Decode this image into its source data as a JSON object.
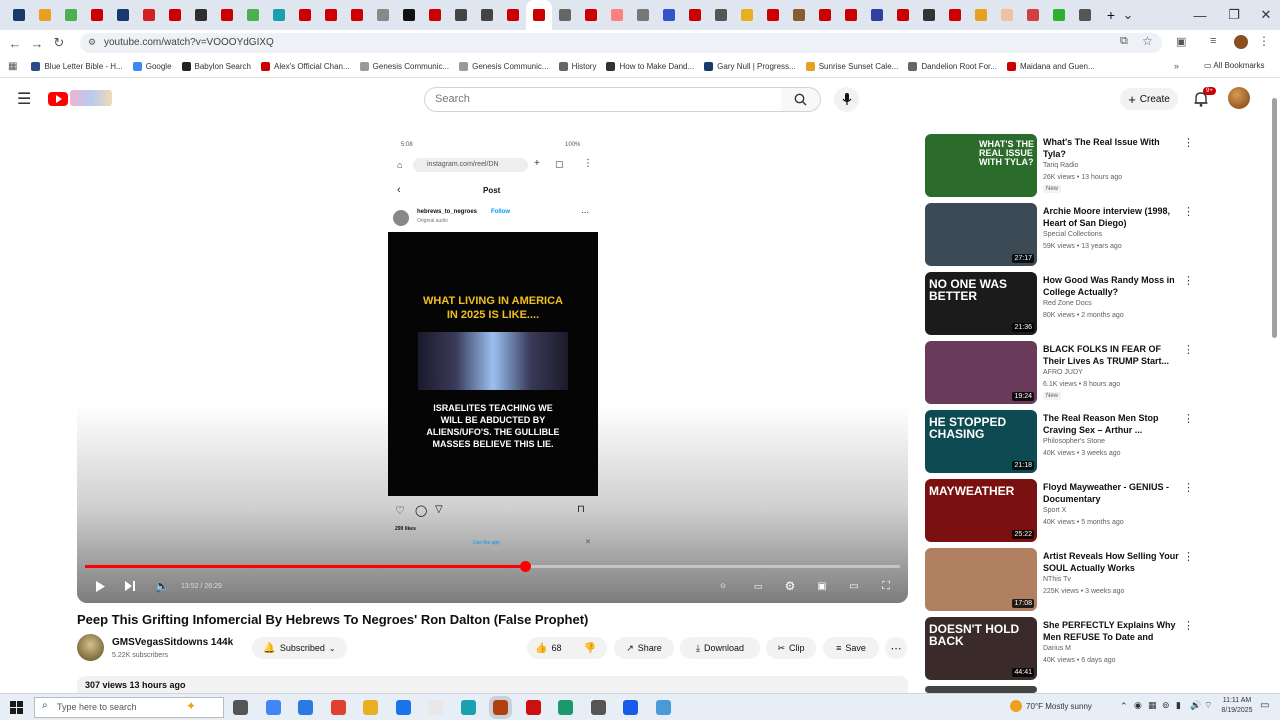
{
  "browser": {
    "tab_colors": [
      "#1a3a6b",
      "#e8a020",
      "#4caf50",
      "#cc0000",
      "#1a3a6b",
      "#d42020",
      "#cc0000",
      "#2f2f2f",
      "#cc0000",
      "#4caf50",
      "#1aa0b0",
      "#cc0000",
      "#cc0000",
      "#cc0000",
      "#888888",
      "#111111",
      "#cc0000",
      "#444444",
      "#444444",
      "#cc0000",
      "#cc0000",
      "#666666",
      "#cc0000",
      "#ff8080",
      "#777777",
      "#3355cc",
      "#cc0000",
      "#555555",
      "#e8b020",
      "#cc0000",
      "#8a5a30",
      "#cc0000",
      "#cc0000",
      "#3040a0",
      "#cc0000",
      "#333333",
      "#cc0000",
      "#e8a020",
      "#f0c0a0",
      "#d04040",
      "#30b030",
      "#555555"
    ],
    "url": "youtube.com/watch?v=VOOOYdGIXQ",
    "bookmarks": [
      {
        "label": "Blue Letter Bible - H...",
        "color": "#2a4a8a"
      },
      {
        "label": "Google",
        "color": "#4285f4"
      },
      {
        "label": "Babylon Search",
        "color": "#222222"
      },
      {
        "label": "Alex's Official Chan...",
        "color": "#cc0000"
      },
      {
        "label": "Genesis Communic...",
        "color": "#999999"
      },
      {
        "label": "Genesis Communic...",
        "color": "#999999"
      },
      {
        "label": "History",
        "color": "#666666"
      },
      {
        "label": "How to Make Dand...",
        "color": "#333333"
      },
      {
        "label": "Gary Null | Progress...",
        "color": "#1a3a6b"
      },
      {
        "label": "Sunrise Sunset Cale...",
        "color": "#e8a020"
      },
      {
        "label": "Dandelion Root For...",
        "color": "#666666"
      },
      {
        "label": "Maidana and Guen...",
        "color": "#cc0000"
      }
    ],
    "all_bookmarks": "All Bookmarks"
  },
  "header": {
    "search_placeholder": "Search",
    "create_label": "Create",
    "bell_badge": "9+"
  },
  "player": {
    "status_time": "5:08",
    "status_battery": "100%",
    "phone_url": "instagram.com/reel/DN",
    "post_header": "Post",
    "post_user": "hebrews_to_negroes",
    "post_follow": "Follow",
    "post_audio": "Original audio",
    "post_text_top": "WHAT LIVING IN AMERICA IN 2025 IS LIKE....",
    "post_text_bottom": "ISRAELITES TEACHING WE WILL BE ABDUCTED BY ALIENS/UFO'S. THE GULLIBLE MASSES BELIEVE THIS LIE.",
    "likes": "299 likes",
    "use_app": "Use the app",
    "time_display": "13:52 / 26:29",
    "progress": 0.54,
    "quality_badge": "HD"
  },
  "video": {
    "title": "Peep This Grifting Infomercial By Hebrews To Negroes' Ron Dalton (False Prophet)",
    "channel": "GMSVegasSitdowns 144k",
    "subscribers": "5.22K subscribers",
    "subscribed": "Subscribed",
    "likes": "68",
    "share": "Share",
    "download": "Download",
    "clip": "Clip",
    "save": "Save",
    "views": "307 views  13 hours ago"
  },
  "recommendations": [
    {
      "title": "What's The Real Issue With Tyla?",
      "channel": "Tariq Radio",
      "meta": "26K views • 13 hours ago",
      "badge": "New",
      "thumb_text": "WHAT'S THE REAL ISSUE WITH TYLA?",
      "bg": "#2b6b2b"
    },
    {
      "title": "Archie Moore interview (1998, Heart of San Diego)",
      "channel": "Special Collections",
      "meta": "59K views • 13 years ago",
      "badge": "",
      "duration": "27:17",
      "bg": "#3c4a55"
    },
    {
      "title": "How Good Was Randy Moss in College Actually?",
      "channel": "Red Zone Docs",
      "meta": "80K views • 2 months ago",
      "badge": "",
      "duration": "21:36",
      "thumb_text": "NO ONE WAS BETTER",
      "bg": "#1b1b1b"
    },
    {
      "title": "BLACK FOLKS IN FEAR OF Their Lives As TRUMP Start...",
      "channel": "AFRO JUDY",
      "meta": "6.1K views • 8 hours ago",
      "badge": "New",
      "duration": "19:24",
      "bg": "#6a3a5a"
    },
    {
      "title": "The Real Reason Men Stop Craving Sex – Arthur ...",
      "channel": "Philosopher's Stone",
      "meta": "40K views • 3 weeks ago",
      "badge": "",
      "duration": "21:18",
      "thumb_text": "HE STOPPED CHASING",
      "bg": "#0e4a52"
    },
    {
      "title": "Floyd Mayweather - GENIUS - Documentary",
      "channel": "Sport X",
      "meta": "40K views • 5 months ago",
      "badge": "",
      "duration": "25:22",
      "thumb_text": "MAYWEATHER",
      "bg": "#7a1010"
    },
    {
      "title": "Artist Reveals How Selling Your SOUL Actually Works",
      "channel": "NThis Tv",
      "meta": "225K views • 3 weeks ago",
      "badge": "",
      "duration": "17:08",
      "bg": "#b08060"
    },
    {
      "title": "She PERFECTLY Explains Why Men REFUSE To Date and Marr...",
      "channel": "Darius M",
      "meta": "40K views • 6 days ago",
      "badge": "",
      "duration": "44:41",
      "thumb_text": "DOESN'T HOLD BACK",
      "bg": "#3a2a2a"
    }
  ],
  "taskbar": {
    "search_placeholder": "Type here to search",
    "weather": "70°F  Mostly sunny",
    "time": "11:11 AM",
    "date": "8/19/2025",
    "icon_colors": [
      "#555555",
      "#4285f4",
      "#2a7ae2",
      "#e04030",
      "#e8b020",
      "#1a73e8",
      "#e8e8e8",
      "#1aa0b0",
      "#b04010",
      "#cc1010",
      "#1a9a6a",
      "#555555",
      "#1a5ae8",
      "#4a9ad8"
    ]
  },
  "colors": {
    "youtube_red": "#ff0000",
    "accent_blue": "#065fd4"
  }
}
